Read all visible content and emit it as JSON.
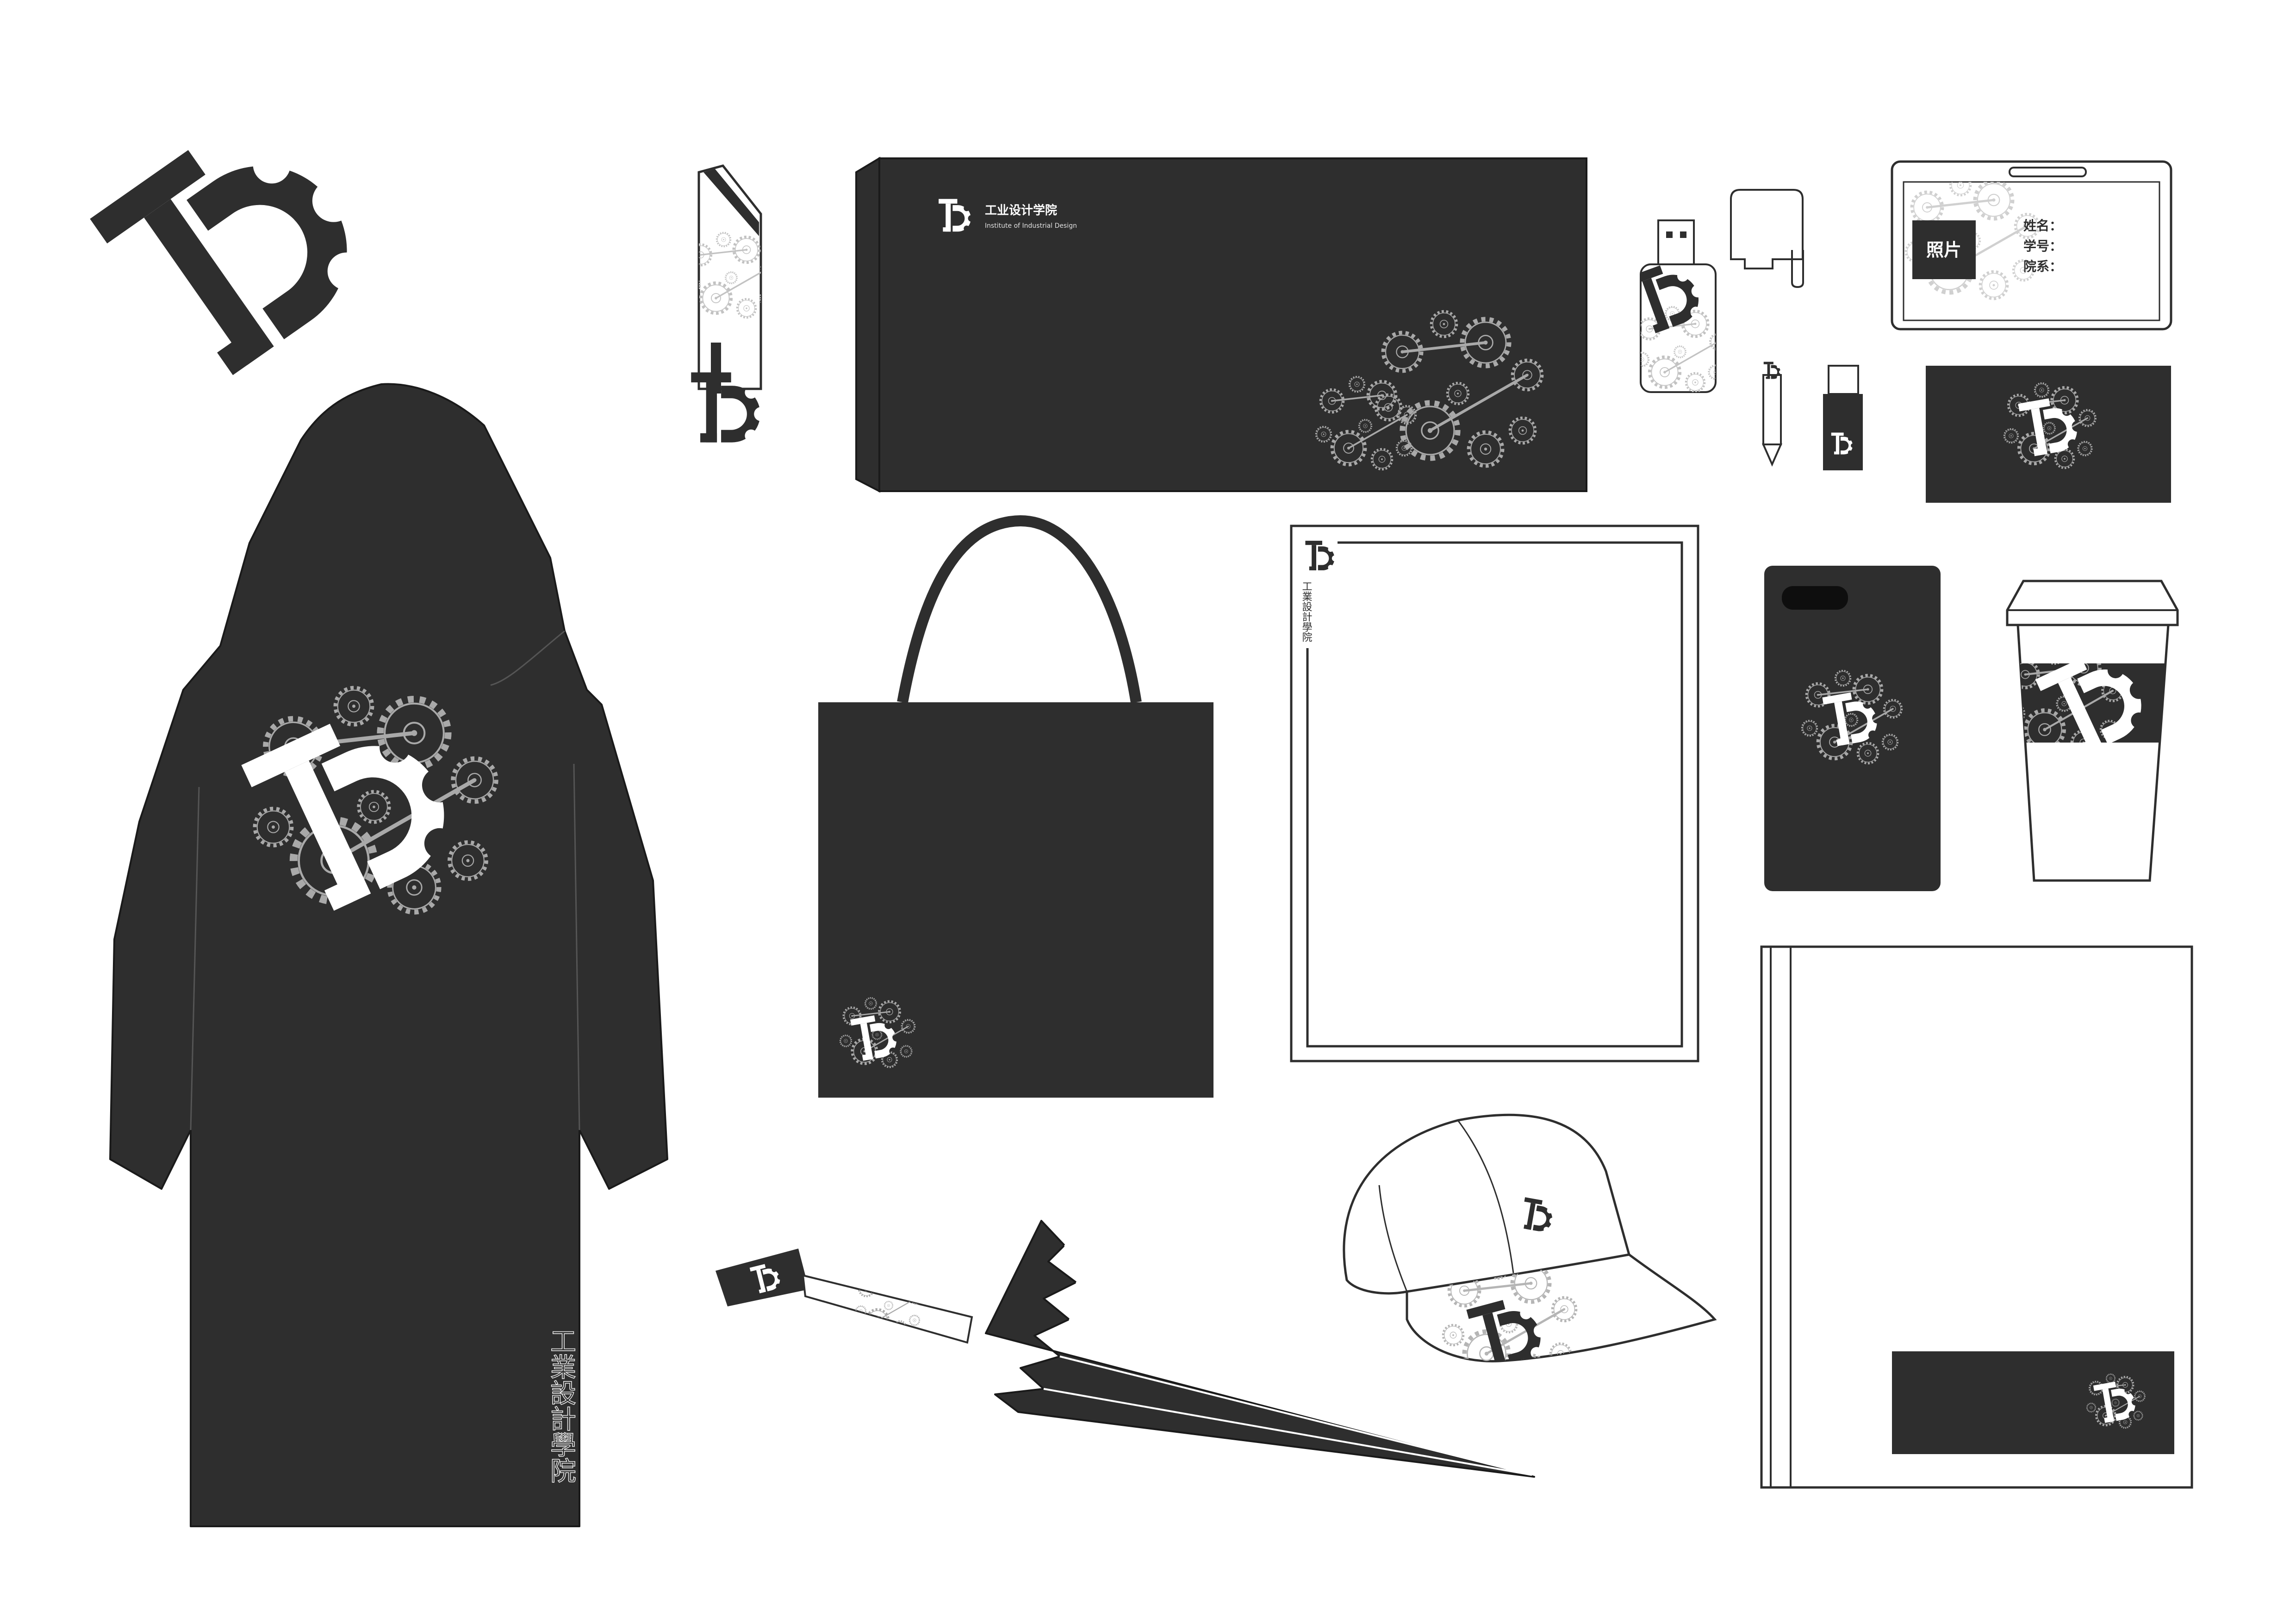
{
  "brand": {
    "name_cn": "工业设计学院",
    "name_en": "Institute of Industrial Design",
    "vertical_name": "工業設計學院"
  },
  "id_card": {
    "photo_label": "照片",
    "fields": [
      "姓名：",
      "学号：",
      "院系："
    ]
  },
  "colors": {
    "primary": "#2e2e2e",
    "background": "#ffffff",
    "pattern_on_dark": "#a9a9a9",
    "pattern_on_light": "#c2c2c2"
  },
  "icons": [
    "gear-d-logo",
    "gear-pattern"
  ]
}
